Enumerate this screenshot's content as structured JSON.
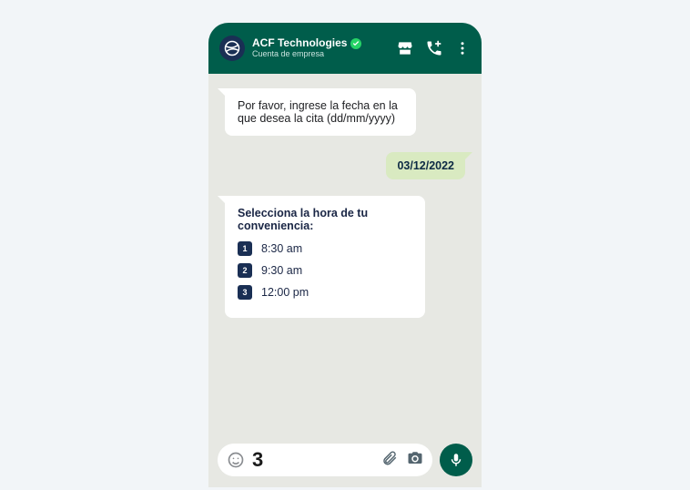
{
  "header": {
    "title": "ACF Technologies",
    "subtitle": "Cuenta de empresa"
  },
  "messages": {
    "prompt_date": "Por favor, ingrese la fecha en la que desea la cita (dd/mm/yyyy)",
    "user_date": "03/12/2022",
    "prompt_time_title": "Selecciona la hora de tu conveniencia:",
    "options": [
      {
        "num": "1",
        "label": "8:30 am"
      },
      {
        "num": "2",
        "label": "9:30 am"
      },
      {
        "num": "3",
        "label": "12:00 pm"
      }
    ]
  },
  "input": {
    "value": "3"
  }
}
